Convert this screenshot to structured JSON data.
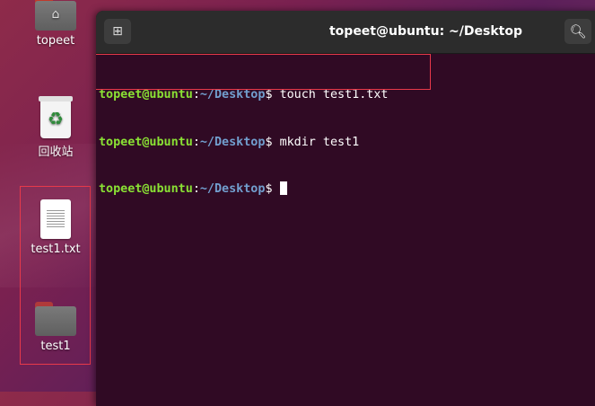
{
  "desktop": {
    "icons": [
      {
        "label": "topeet"
      },
      {
        "label": "回收站"
      },
      {
        "label": "test1.txt"
      },
      {
        "label": "test1"
      }
    ]
  },
  "terminal": {
    "title": "topeet@ubuntu: ~/Desktop",
    "prompt_user": "topeet@ubuntu",
    "prompt_sep": ":",
    "prompt_path": "~/Desktop",
    "prompt_symbol": "$",
    "lines": [
      {
        "command": "touch test1.txt"
      },
      {
        "command": "mkdir test1"
      },
      {
        "command": ""
      }
    ]
  },
  "colors": {
    "terminal_bg": "#300a24",
    "prompt_user": "#8ae234",
    "prompt_path": "#729fcf",
    "highlight": "#e8394a"
  }
}
